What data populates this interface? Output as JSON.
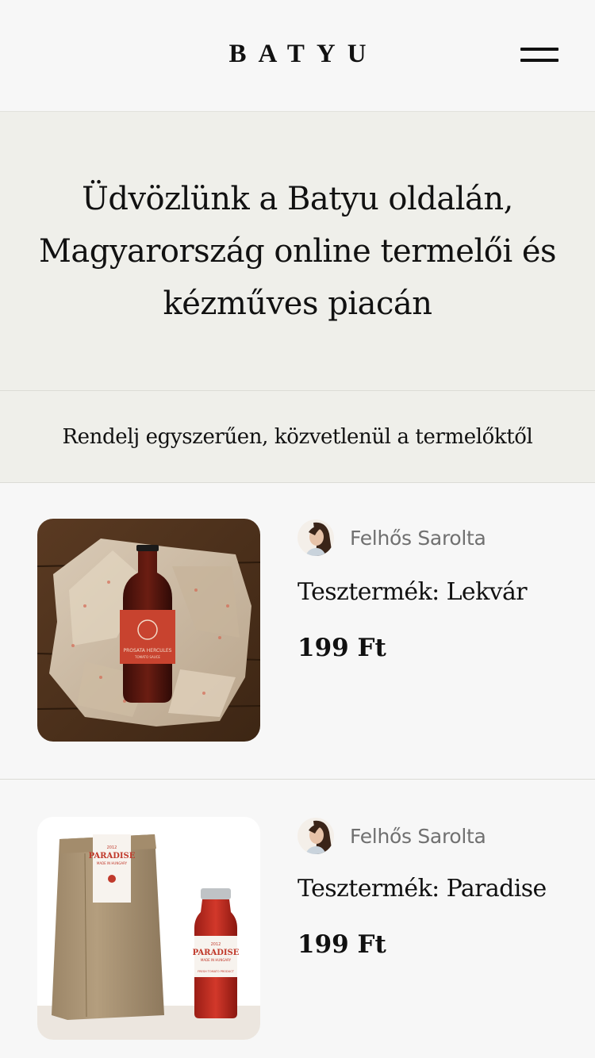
{
  "header": {
    "logo": "BATYU",
    "menu_icon": "hamburger-menu-icon"
  },
  "hero": {
    "title": "Üdvözlünk a Batyu oldalán, Magyarország online termelői és kézműves piacán"
  },
  "tagline": {
    "text": "Rendelj egyszerűen, közvetlenül a termelőktől"
  },
  "products": [
    {
      "seller": "Felhős Sarolta",
      "name": "Tesztermék: Lekvár",
      "price": "199 Ft",
      "image_label": "PROSATA HERCULES",
      "image_sublabel": "TOMATO SAUCE"
    },
    {
      "seller": "Felhős Sarolta",
      "name": "Tesztermék: Paradise",
      "price": "199 Ft",
      "bag_label_top": "2012",
      "bag_label": "PARADISE",
      "bag_label_sub": "MADE IN HUNGARY",
      "jar_label_top": "2012",
      "jar_label": "PARADISE",
      "jar_label_sub": "MADE IN HUNGARY",
      "jar_label_bottom": "FRESH TOMATO PRODUCT"
    }
  ],
  "colors": {
    "background": "#f7f7f7",
    "hero_background": "#efefea",
    "text": "#111111",
    "seller_text": "#707070"
  }
}
